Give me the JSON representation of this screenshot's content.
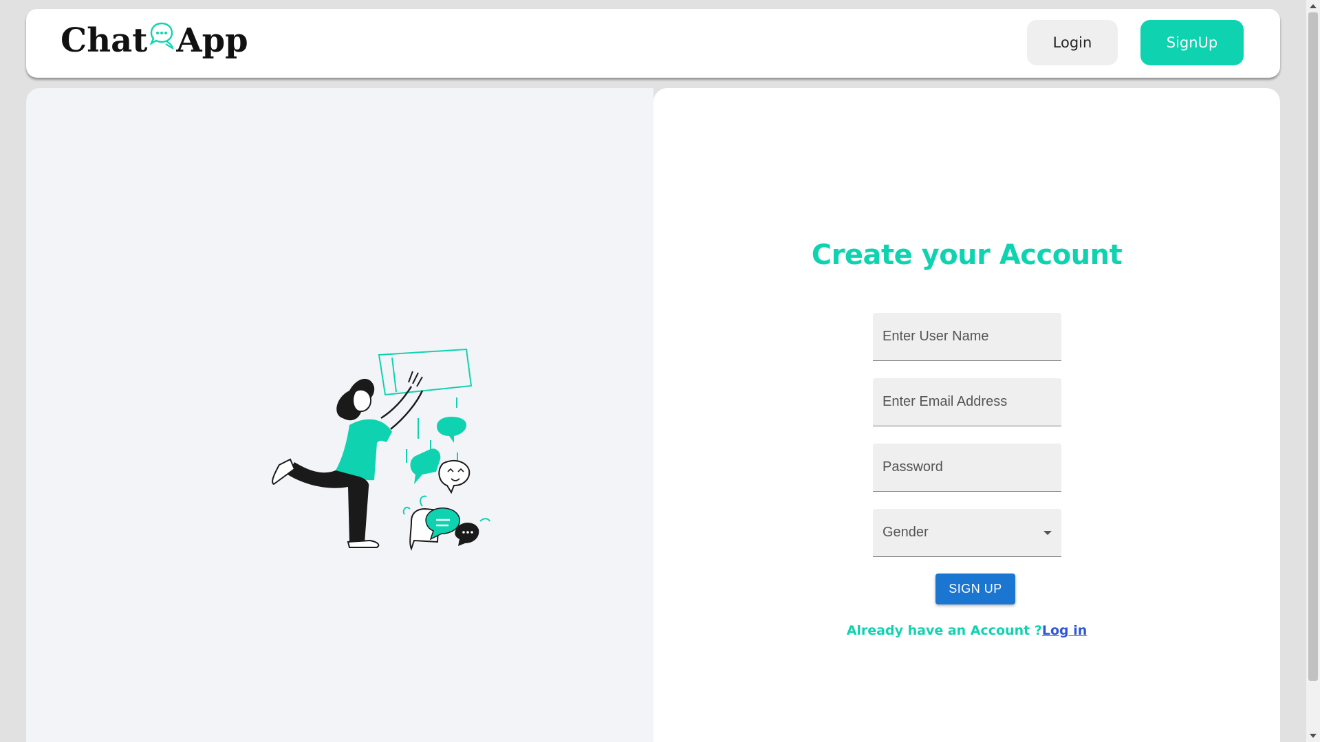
{
  "header": {
    "logo_left": "Chat",
    "logo_right": "App",
    "login_label": "Login",
    "signup_label": "SignUp"
  },
  "form": {
    "title": "Create your Account",
    "username_placeholder": "Enter User Name",
    "email_placeholder": "Enter Email Address",
    "password_placeholder": "Password",
    "gender_label": "Gender",
    "submit_label": "SIGN UP",
    "prompt_text": "Already have an Account ?",
    "login_link": "Log in"
  },
  "colors": {
    "brand": "#0fd3b0",
    "submit": "#1b76d2",
    "link": "#2f56d6"
  },
  "icons": {
    "logo_bubble": "chat-bubble-icon",
    "gender_caret": "caret-down-icon"
  }
}
